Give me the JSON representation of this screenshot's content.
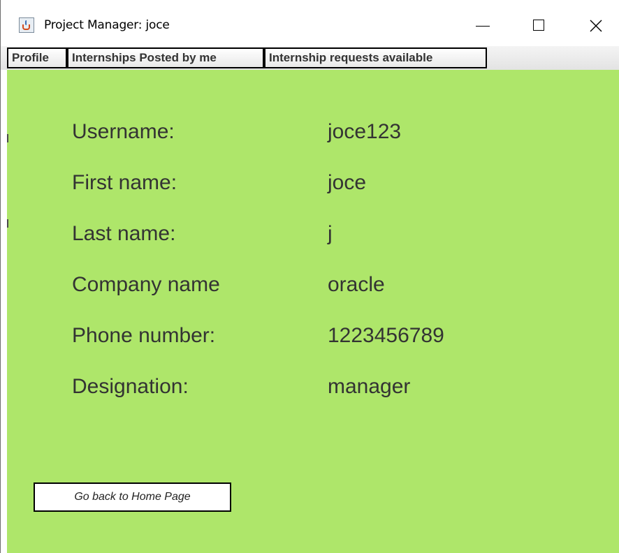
{
  "window": {
    "title": "Project Manager: joce",
    "icon": "java-cup-icon",
    "controls": [
      "minimize-icon",
      "maximize-icon",
      "close-icon"
    ]
  },
  "tabs": [
    {
      "label": "Profile"
    },
    {
      "label": "Internships Posted by me"
    },
    {
      "label": "Internship requests available"
    }
  ],
  "profile": {
    "username_label": "Username:",
    "username_value": "joce123",
    "first_name_label": "First name:",
    "first_name_value": "joce",
    "last_name_label": "Last name:",
    "last_name_value": "j",
    "company_label": "Company name",
    "company_value": "oracle",
    "phone_label": "Phone number:",
    "phone_value": "1223456789",
    "designation_label": "Designation:",
    "designation_value": "manager"
  },
  "actions": {
    "home_button_label": "Go back to Home Page"
  },
  "colors": {
    "panel_background": "#aee66a",
    "text": "#333333"
  }
}
